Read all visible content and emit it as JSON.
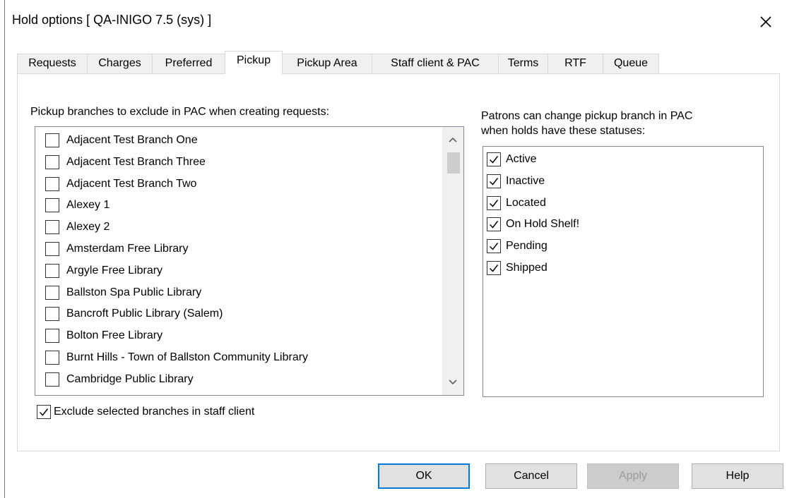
{
  "window": {
    "title": "Hold options [ QA-INIGO 7.5 (sys) ]",
    "close_icon": "close-icon"
  },
  "tabs": [
    {
      "label": "Requests",
      "active": false
    },
    {
      "label": "Charges",
      "active": false
    },
    {
      "label": "Preferred",
      "active": false
    },
    {
      "label": "Pickup",
      "active": true
    },
    {
      "label": "Pickup Area",
      "active": false
    },
    {
      "label": "Staff client & PAC",
      "active": false
    },
    {
      "label": "Terms",
      "active": false
    },
    {
      "label": "RTF",
      "active": false
    },
    {
      "label": "Queue",
      "active": false
    }
  ],
  "pickup": {
    "exclude_label": "Pickup branches to exclude in PAC when creating requests:",
    "branches": [
      {
        "label": "Adjacent Test Branch One",
        "checked": false
      },
      {
        "label": "Adjacent Test Branch Three",
        "checked": false
      },
      {
        "label": "Adjacent Test Branch Two",
        "checked": false
      },
      {
        "label": "Alexey 1",
        "checked": false
      },
      {
        "label": "Alexey 2",
        "checked": false
      },
      {
        "label": "Amsterdam Free Library",
        "checked": false
      },
      {
        "label": "Argyle Free Library",
        "checked": false
      },
      {
        "label": "Ballston Spa Public Library",
        "checked": false
      },
      {
        "label": "Bancroft Public Library (Salem)",
        "checked": false
      },
      {
        "label": "Bolton Free Library",
        "checked": false
      },
      {
        "label": "Burnt Hills - Town of Ballston Community Library",
        "checked": false
      },
      {
        "label": "Cambridge Public Library",
        "checked": false
      }
    ],
    "exclude_staff_label": "Exclude selected branches in staff client",
    "exclude_staff_checked": true,
    "statuses_label_line1": "Patrons can change pickup branch in PAC",
    "statuses_label_line2": "when holds have these statuses:",
    "statuses": [
      {
        "label": "Active",
        "checked": true
      },
      {
        "label": "Inactive",
        "checked": true
      },
      {
        "label": "Located",
        "checked": true
      },
      {
        "label": "On Hold Shelf!",
        "checked": true
      },
      {
        "label": "Pending",
        "checked": true
      },
      {
        "label": "Shipped",
        "checked": true
      }
    ]
  },
  "buttons": {
    "ok": "OK",
    "cancel": "Cancel",
    "apply": "Apply",
    "help": "Help"
  },
  "colors": {
    "default_button_border": "#0078d7",
    "disabled_text": "#9a9a9a"
  }
}
